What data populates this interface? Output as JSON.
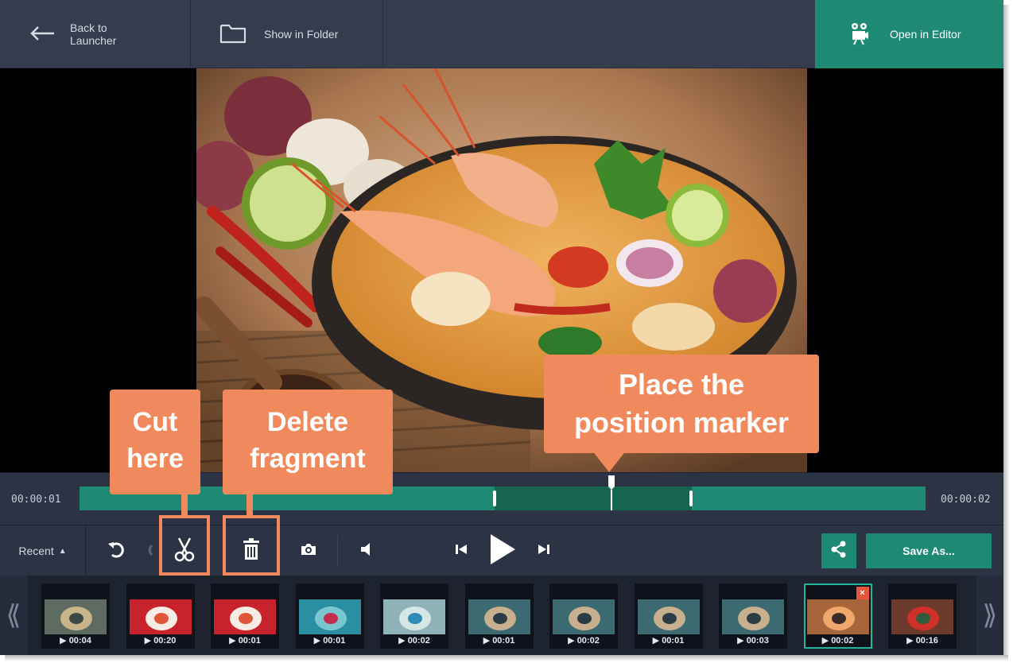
{
  "topbar": {
    "back_label": "Back to\nLauncher",
    "folder_label": "Show in Folder",
    "editor_label": "Open in\nEditor"
  },
  "timeline": {
    "start_time": "00:00:01",
    "end_time": "00:00:02"
  },
  "controls": {
    "recent_label": "Recent",
    "save_label": "Save As..."
  },
  "recent_items": [
    {
      "duration": "00:04",
      "theme": "person"
    },
    {
      "duration": "00:20",
      "theme": "food-red"
    },
    {
      "duration": "00:01",
      "theme": "food-red"
    },
    {
      "duration": "00:01",
      "theme": "water"
    },
    {
      "duration": "00:02",
      "theme": "bird"
    },
    {
      "duration": "00:01",
      "theme": "dog"
    },
    {
      "duration": "00:02",
      "theme": "dog"
    },
    {
      "duration": "00:01",
      "theme": "dog"
    },
    {
      "duration": "00:03",
      "theme": "dog"
    },
    {
      "duration": "00:02",
      "theme": "soup",
      "selected": true
    },
    {
      "duration": "00:16",
      "theme": "person-red"
    }
  ],
  "callouts": {
    "cut": "Cut\nhere",
    "delete": "Delete\nfragment",
    "position": "Place the\nposition marker"
  },
  "colors": {
    "accent": "#1f8a74",
    "callout": "#f08a5d",
    "background": "#2c3345"
  }
}
